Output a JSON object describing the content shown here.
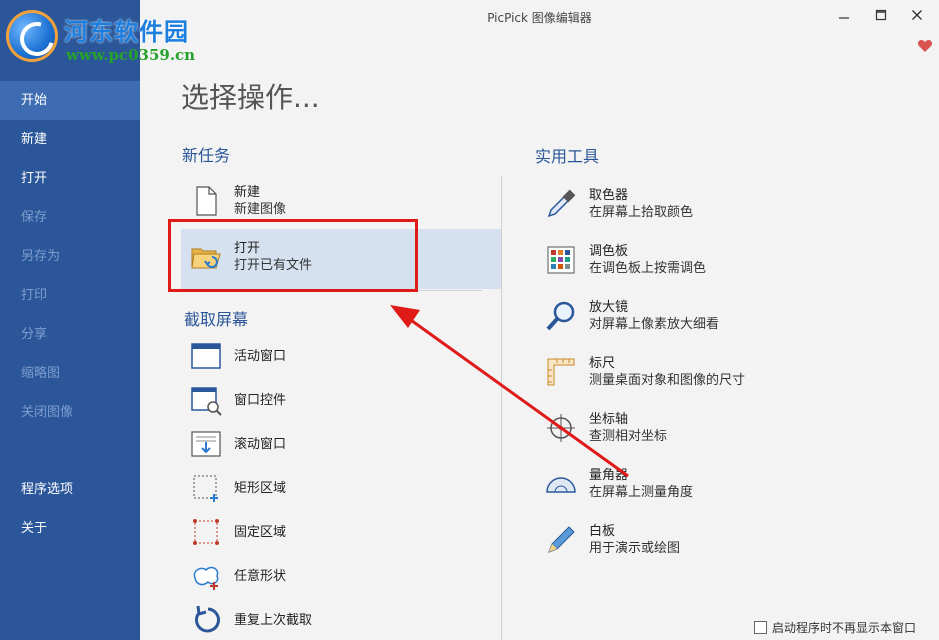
{
  "window": {
    "title": "PicPick 图像编辑器"
  },
  "watermark": {
    "name": "河东软件园",
    "url": "www.pc0359.cn"
  },
  "sidebar": {
    "items": [
      {
        "label": "开始"
      },
      {
        "label": "新建"
      },
      {
        "label": "打开"
      },
      {
        "label": "保存"
      },
      {
        "label": "另存为"
      },
      {
        "label": "打印"
      },
      {
        "label": "分享"
      },
      {
        "label": "缩略图"
      },
      {
        "label": "关闭图像"
      }
    ],
    "lower": [
      {
        "label": "程序选项"
      },
      {
        "label": "关于"
      }
    ]
  },
  "main": {
    "heading": "选择操作...",
    "new_task": {
      "title": "新任务",
      "items": [
        {
          "label": "新建",
          "desc": "新建图像"
        },
        {
          "label": "打开",
          "desc": "打开已有文件"
        }
      ]
    },
    "capture": {
      "title": "截取屏幕",
      "items": [
        {
          "label": "活动窗口"
        },
        {
          "label": "窗口控件"
        },
        {
          "label": "滚动窗口"
        },
        {
          "label": "矩形区域"
        },
        {
          "label": "固定区域"
        },
        {
          "label": "任意形状"
        },
        {
          "label": "重复上次截取"
        }
      ]
    },
    "tools": {
      "title": "实用工具",
      "items": [
        {
          "label": "取色器",
          "desc": "在屏幕上拾取颜色"
        },
        {
          "label": "调色板",
          "desc": "在调色板上按需调色"
        },
        {
          "label": "放大镜",
          "desc": "对屏幕上像素放大细看"
        },
        {
          "label": "标尺",
          "desc": "测量桌面对象和图像的尺寸"
        },
        {
          "label": "坐标轴",
          "desc": "查测相对坐标"
        },
        {
          "label": "量角器",
          "desc": "在屏幕上测量角度"
        },
        {
          "label": "白板",
          "desc": "用于演示或绘图"
        }
      ]
    },
    "startup_checkbox": {
      "label": "启动程序时不再显示本窗口",
      "checked": false
    }
  },
  "colors": {
    "sidebar": "#2b579a",
    "accent": "#2b579a",
    "highlight": "#d6e1ef",
    "annotation": "#e01919"
  }
}
